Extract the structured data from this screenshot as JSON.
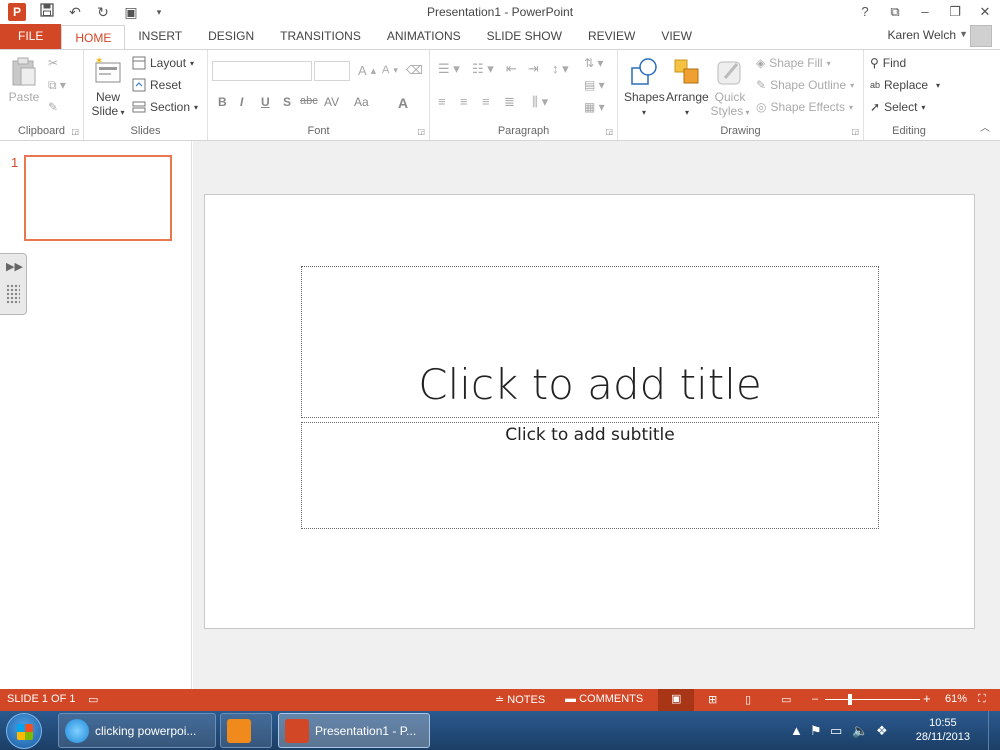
{
  "titlebar": {
    "title": "Presentation1 - PowerPoint",
    "app_icon_letter": "P",
    "controls": [
      "?",
      "⧉",
      "–",
      "❐",
      "✕"
    ]
  },
  "tabs": [
    "FILE",
    "HOME",
    "INSERT",
    "DESIGN",
    "TRANSITIONS",
    "ANIMATIONS",
    "SLIDE SHOW",
    "REVIEW",
    "VIEW"
  ],
  "active_tab": "HOME",
  "user": {
    "name": "Karen Welch"
  },
  "ribbon": {
    "clipboard": {
      "label": "Clipboard",
      "paste": "Paste"
    },
    "slides": {
      "label": "Slides",
      "new_slide_line1": "New",
      "new_slide_line2": "Slide",
      "layout": "Layout",
      "reset": "Reset",
      "section": "Section"
    },
    "font": {
      "label": "Font",
      "bold": "B",
      "italic": "I",
      "underline": "U",
      "shadow": "S",
      "strike": "abc",
      "spacing": "AV",
      "case": "Aa",
      "color": "A",
      "grow": "A",
      "shrink": "A"
    },
    "paragraph": {
      "label": "Paragraph"
    },
    "drawing": {
      "label": "Drawing",
      "shapes": "Shapes",
      "arrange": "Arrange",
      "quick_styles_line1": "Quick",
      "quick_styles_line2": "Styles",
      "shape_fill": "Shape Fill",
      "shape_outline": "Shape Outline",
      "shape_effects": "Shape Effects"
    },
    "editing": {
      "label": "Editing",
      "find": "Find",
      "replace": "Replace",
      "select": "Select"
    }
  },
  "thumbs": {
    "number": "1"
  },
  "slide": {
    "title_placeholder": "Click to add title",
    "subtitle_placeholder": "Click to add subtitle"
  },
  "statusbar": {
    "slide_info": "SLIDE 1 OF 1",
    "notes": "NOTES",
    "comments": "COMMENTS",
    "zoom": "61%",
    "zoom_minus": "–",
    "zoom_plus": "+"
  },
  "taskbar": {
    "items": [
      {
        "label": "clicking powerpoi..."
      },
      {
        "label": ""
      },
      {
        "label": "Presentation1 - P..."
      }
    ],
    "time": "10:55",
    "date": "28/11/2013"
  }
}
